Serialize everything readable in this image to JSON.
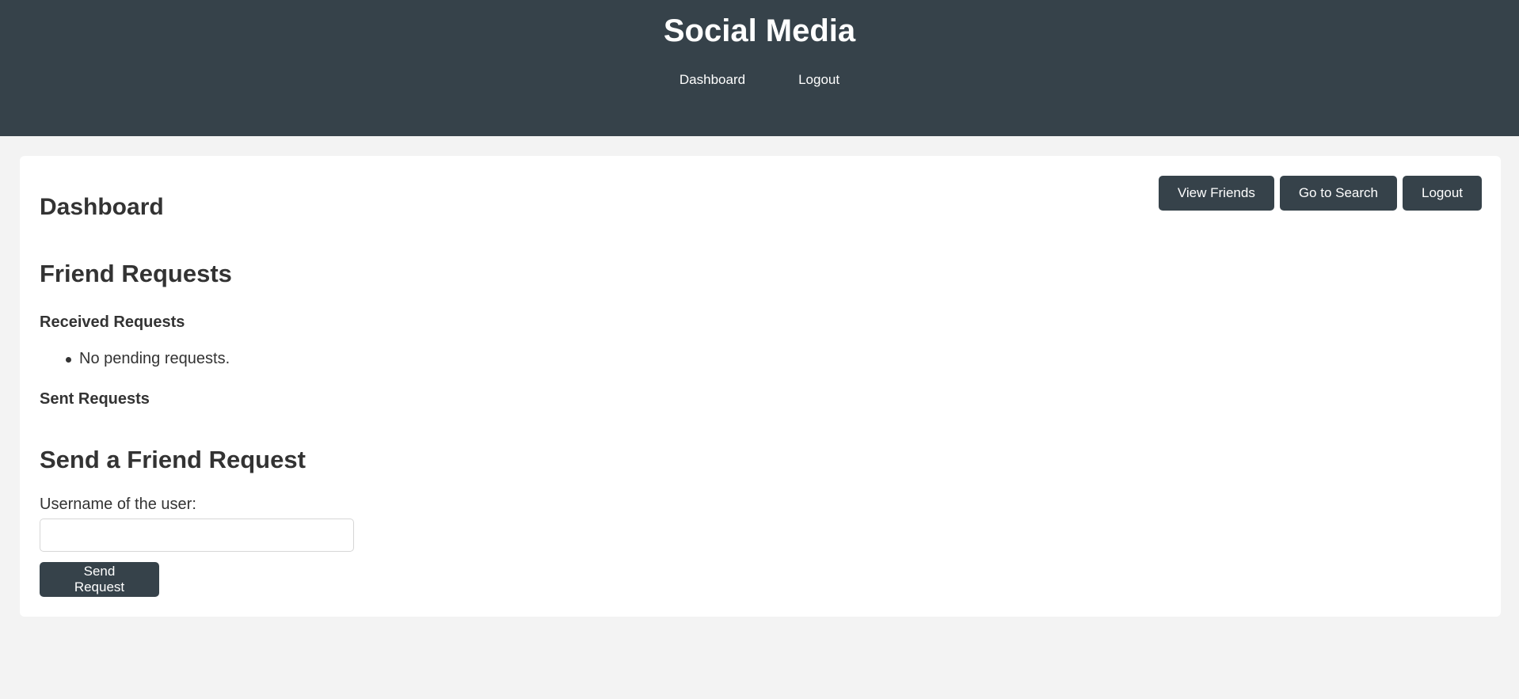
{
  "header": {
    "title": "Social Media",
    "nav": {
      "dashboard": "Dashboard",
      "logout": "Logout"
    },
    "background_color": "#36424a"
  },
  "main": {
    "title": "Dashboard",
    "actions": {
      "view_friends": "View Friends",
      "go_to_search": "Go to Search",
      "logout": "Logout"
    },
    "friend_requests": {
      "heading": "Friend Requests",
      "received_heading": "Received Requests",
      "received_items": [
        "No pending requests."
      ],
      "sent_heading": "Sent Requests"
    },
    "send_request": {
      "heading": "Send a Friend Request",
      "username_label": "Username of the user:",
      "username_value": "",
      "submit_label": "Send Request"
    }
  },
  "colors": {
    "accent": "#36424a",
    "page_background": "#f3f3f3",
    "card_background": "#ffffff",
    "text": "#333333"
  }
}
